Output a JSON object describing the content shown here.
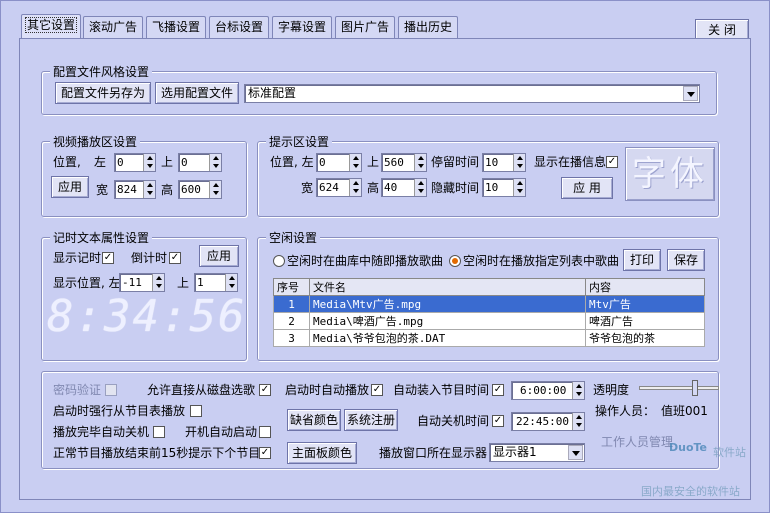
{
  "tabs": [
    "其它设置",
    "滚动广告",
    "飞播设置",
    "台标设置",
    "字幕设置",
    "图片广告",
    "播出历史"
  ],
  "close_label": "关 闭",
  "config": {
    "legend": "配置文件风格设置",
    "save_as": "配置文件另存为",
    "use_config": "选用配置文件",
    "selected": "标准配置"
  },
  "video": {
    "legend": "视频播放区设置",
    "pos_label": "位置,",
    "left_label": "左",
    "left": "0",
    "top_label": "上",
    "top": "0",
    "apply": "应用",
    "width_label": "宽",
    "width": "824",
    "height_label": "高",
    "height": "600"
  },
  "hint": {
    "legend": "提示区设置",
    "pos_label": "位置, 左",
    "left": "0",
    "top_label": "上",
    "top": "560",
    "stay_label": "停留时间",
    "stay": "10",
    "show_label": "显示在播信息",
    "width_label": "宽",
    "width": "624",
    "height_label": "高",
    "height": "40",
    "hide_label": "隐藏时间",
    "hide": "10",
    "apply": "应 用",
    "font_button": "字体"
  },
  "timer": {
    "legend": "记时文本属性设置",
    "show_label": "显示记时",
    "countdown_label": "倒计时",
    "apply": "应用",
    "pos_label": "显示位置, 左",
    "left": "-11",
    "top_label": "上",
    "top": "1",
    "clock": "8:34:56"
  },
  "idle": {
    "legend": "空闲设置",
    "radio1": "空闲时在曲库中随即播放歌曲",
    "radio2": "空闲时在播放指定列表中歌曲",
    "print": "打印",
    "save": "保存",
    "columns": [
      "序号",
      "文件名",
      "内容"
    ],
    "rows": [
      {
        "no": "1",
        "file": "Media\\Mtv广告.mpg",
        "content": "Mtv广告"
      },
      {
        "no": "2",
        "file": "Media\\啤酒广告.mpg",
        "content": "啤酒广告"
      },
      {
        "no": "3",
        "file": "Media\\爷爷包泡的茶.DAT",
        "content": "爷爷包泡的茶"
      }
    ]
  },
  "bottom": {
    "password": "密码验证",
    "allow_disk": "允许直接从磁盘选歌",
    "auto_play": "启动时自动播放",
    "auto_load": "自动装入节目时间",
    "load_time": "6:00:00",
    "transparency": "透明度",
    "force_play": "启动时强行从节目表播放",
    "default_color": "缺省颜色",
    "sys_register": "系统注册",
    "auto_shutdown": "自动关机时间",
    "shutdown_time": "22:45:00",
    "operator_label": "操作人员：",
    "operator": "值班001",
    "finish_shutdown": "播放完毕自动关机",
    "boot_start": "开机自动启动",
    "panel_color": "主面板颜色",
    "window_label": "播放窗口所在显示器",
    "display": "显示器1",
    "prompt_next": "正常节目播放结束前15秒提示下个节目",
    "staff_label": "工作人员管理",
    "transparency_level": 0.7
  },
  "watermark": {
    "site": "DuoTe",
    "line1": "软件站",
    "line2": "国内最安全的软件站"
  }
}
